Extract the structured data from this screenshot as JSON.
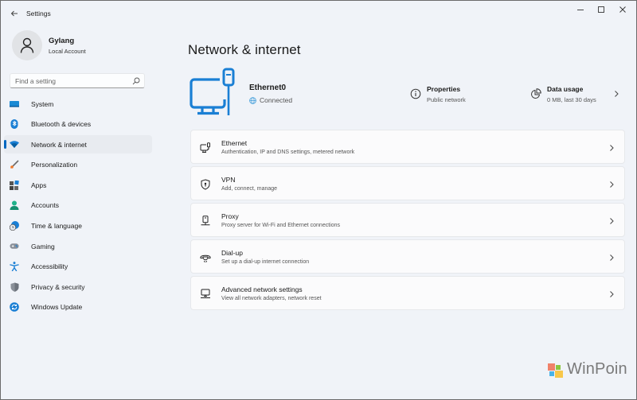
{
  "window": {
    "app_title": "Settings",
    "controls": {
      "minimize": "minimize",
      "maximize": "maximize",
      "close": "close"
    }
  },
  "profile": {
    "name": "Gylang",
    "account_type": "Local Account"
  },
  "search": {
    "placeholder": "Find a setting",
    "value": ""
  },
  "sidebar": {
    "active": "Network & internet",
    "items": [
      {
        "label": "System",
        "icon": "system-icon"
      },
      {
        "label": "Bluetooth & devices",
        "icon": "bluetooth-icon"
      },
      {
        "label": "Network & internet",
        "icon": "wifi-icon"
      },
      {
        "label": "Personalization",
        "icon": "brush-icon"
      },
      {
        "label": "Apps",
        "icon": "apps-icon"
      },
      {
        "label": "Accounts",
        "icon": "accounts-icon"
      },
      {
        "label": "Time & language",
        "icon": "time-language-icon"
      },
      {
        "label": "Gaming",
        "icon": "gaming-icon"
      },
      {
        "label": "Accessibility",
        "icon": "accessibility-icon"
      },
      {
        "label": "Privacy & security",
        "icon": "shield-icon"
      },
      {
        "label": "Windows Update",
        "icon": "update-icon"
      }
    ]
  },
  "main": {
    "title": "Network & internet",
    "connection": {
      "name": "Ethernet0",
      "status": "Connected",
      "properties_label": "Properties",
      "properties_value": "Public network",
      "data_usage_label": "Data usage",
      "data_usage_value": "0 MB, last 30 days"
    },
    "cards": [
      {
        "title": "Ethernet",
        "subtitle": "Authentication, IP and DNS settings, metered network",
        "icon": "ethernet-icon"
      },
      {
        "title": "VPN",
        "subtitle": "Add, connect, manage",
        "icon": "vpn-shield-icon"
      },
      {
        "title": "Proxy",
        "subtitle": "Proxy server for Wi-Fi and Ethernet connections",
        "icon": "proxy-icon"
      },
      {
        "title": "Dial-up",
        "subtitle": "Set up a dial-up internet connection",
        "icon": "dialup-icon"
      },
      {
        "title": "Advanced network settings",
        "subtitle": "View all network adapters, network reset",
        "icon": "advanced-network-icon"
      }
    ]
  },
  "watermark": {
    "text": "WinPoin"
  },
  "colors": {
    "accent": "#0067c0",
    "background": "#f0f3f8",
    "card": "#fbfbfc"
  }
}
